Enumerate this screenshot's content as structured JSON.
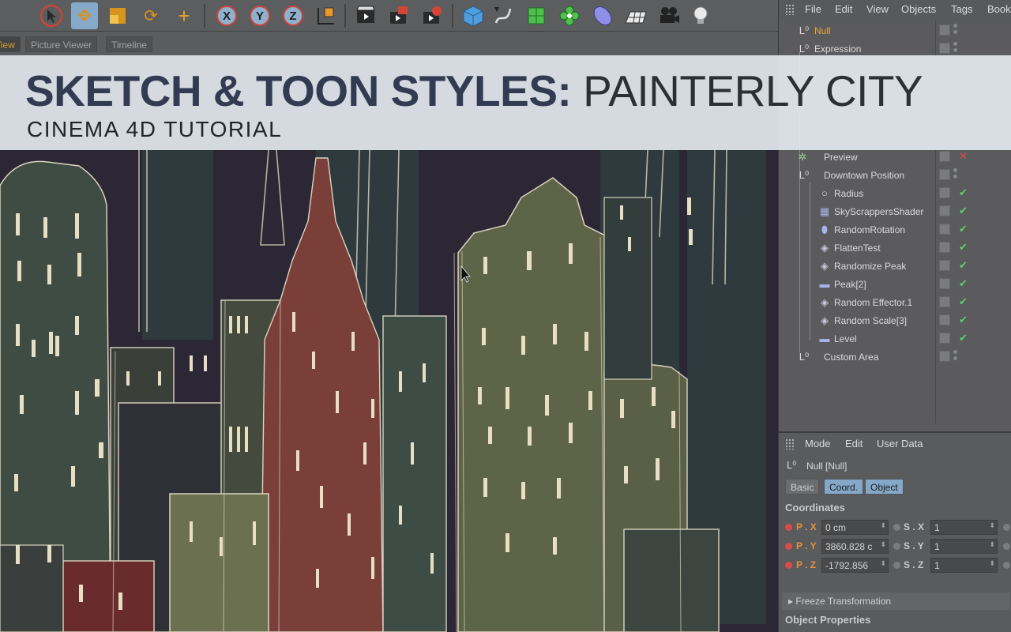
{
  "colors": {
    "accent_highlight": "#87a9c9",
    "active_tab_text": "#d79a2c",
    "check_green": "#5fd06a",
    "axis_red": "#c8453a",
    "banner_bg": "#e2e8ee",
    "title_dark": "#333b52",
    "viewport_sky": "#2c2735"
  },
  "toolbar": {
    "icons": [
      "select-arrow-icon",
      "move-icon",
      "scale-icon",
      "rotate-icon",
      "add-object-icon",
      "x-axis-icon",
      "y-axis-icon",
      "z-axis-icon",
      "coordinate-system-icon",
      "render-view-icon",
      "render-picture-viewer-icon",
      "render-settings-icon",
      "cube-icon",
      "spline-pen-icon",
      "subdivision-icon",
      "mograph-cloner-icon",
      "deformer-icon",
      "floor-icon",
      "camera-icon",
      "light-icon"
    ],
    "axis_labels": {
      "x": "X",
      "y": "Y",
      "z": "Z"
    }
  },
  "view_tabs": [
    {
      "label": "View"
    },
    {
      "label": "Picture Viewer"
    },
    {
      "label": "Timeline"
    }
  ],
  "banner": {
    "title_bold": "SKETCH & TOON STYLES:",
    "title_light": "PAINTERLY CITY",
    "subtitle": "CINEMA 4D TUTORIAL"
  },
  "object_manager": {
    "menu": [
      "File",
      "Edit",
      "View",
      "Objects",
      "Tags",
      "Book"
    ],
    "items": [
      {
        "label": "Null",
        "icon": "null-icon",
        "highlight": true
      },
      {
        "label": "Expression",
        "icon": "null-icon"
      },
      {
        "label": "Preview",
        "icon": "preview-icon"
      },
      {
        "label": "Downtown Position",
        "icon": "null-icon"
      },
      {
        "label": "Radius",
        "icon": "circle-icon"
      },
      {
        "label": "SkyScrappersShader",
        "icon": "shader-icon"
      },
      {
        "label": "RandomRotation",
        "icon": "effector-icon"
      },
      {
        "label": "FlattenTest",
        "icon": "effector-icon"
      },
      {
        "label": "Randomize Peak",
        "icon": "effector-icon"
      },
      {
        "label": "Peak[2]",
        "icon": "effector-icon"
      },
      {
        "label": "Random Effector.1",
        "icon": "effector-icon"
      },
      {
        "label": "Random Scale[3]",
        "icon": "effector-icon"
      },
      {
        "label": "Level",
        "icon": "effector-icon"
      },
      {
        "label": "Custom Area",
        "icon": "null-icon"
      }
    ]
  },
  "attribute_manager": {
    "menu": [
      "Mode",
      "Edit",
      "User Data"
    ],
    "object_label": "Null [Null]",
    "tabs": [
      {
        "label": "Basic",
        "active": false
      },
      {
        "label": "Coord.",
        "active": true
      },
      {
        "label": "Object",
        "active": true
      }
    ],
    "section_title": "Coordinates",
    "coords": [
      {
        "p_label": "P . X",
        "p_value": "0 cm",
        "s_label": "S . X",
        "s_value": "1"
      },
      {
        "p_label": "P . Y",
        "p_value": "3860.828 c",
        "s_label": "S . Y",
        "s_value": "1"
      },
      {
        "p_label": "P . Z",
        "p_value": "-1792.856",
        "s_label": "S . Z",
        "s_value": "1"
      }
    ],
    "freeze_label": "▸ Freeze Transformation",
    "object_properties_label": "Object Properties"
  }
}
